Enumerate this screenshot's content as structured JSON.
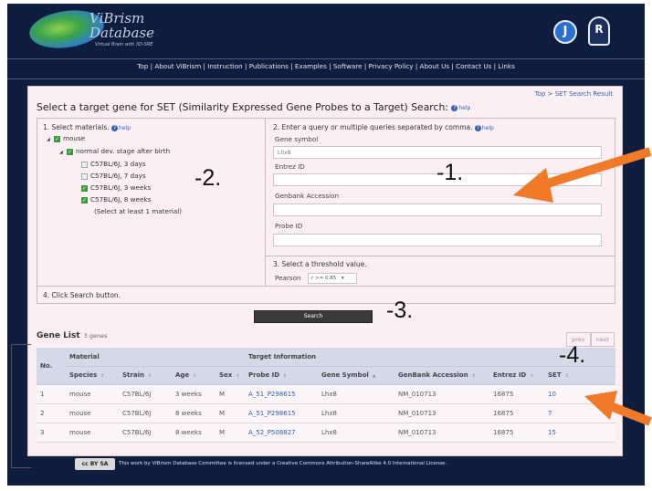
{
  "header": {
    "logo_title_line1": "ViBrism",
    "logo_title_line2": "Database",
    "logo_subtitle": "Virtual Brain with 3D-SRE",
    "badge_left": "J",
    "badge_right": "R"
  },
  "nav": [
    "Top",
    "About ViBrism",
    "Instruction",
    "Publications",
    "Examples",
    "Software",
    "Privacy Policy",
    "About Us",
    "Contact Us",
    "Links"
  ],
  "breadcrumb": {
    "top": "Top",
    "separator": ">",
    "current": "SET Search Result"
  },
  "page_title": "Select a target gene for SET (Similarity Expressed Gene Probes to a Target) Search:",
  "help_label": "help",
  "step1": {
    "label": "1. Select materials.",
    "tree": {
      "root": "mouse",
      "stage": "normal dev. stage after birth",
      "items": [
        {
          "label": "C57BL/6J, 3 days",
          "checked": false
        },
        {
          "label": "C57BL/6J, 7 days",
          "checked": false
        },
        {
          "label": "C57BL/6J, 3 weeks",
          "checked": true
        },
        {
          "label": "C57BL/6J, 8 weeks",
          "checked": true
        }
      ],
      "note": "(Select at least 1 material)"
    }
  },
  "step2": {
    "label": "2. Enter a query or multiple queries separated by comma.",
    "fields": {
      "gene_symbol": {
        "label": "Gene symbol",
        "value": "Lhx8"
      },
      "entrez_id": {
        "label": "Entrez ID",
        "value": ""
      },
      "genbank": {
        "label": "Genbank Accession",
        "value": ""
      },
      "probe_id": {
        "label": "Probe ID",
        "value": ""
      }
    }
  },
  "step3": {
    "label": "3. Select a threshold value.",
    "metric": "Pearson",
    "selected": "r >= 0.85"
  },
  "step4": {
    "label": "4. Click Search button.",
    "button": "Search"
  },
  "gene_list": {
    "title": "Gene List",
    "count": "3 genes",
    "prev": "prev",
    "next": "next",
    "group_material": "Material",
    "group_target": "Target Information",
    "col_no": "No.",
    "columns": [
      "Species",
      "Strain",
      "Age",
      "Sex",
      "Probe ID",
      "Gene Symbol",
      "GenBank Accession",
      "Entrez ID",
      "SET"
    ],
    "rows": [
      [
        "1",
        "mouse",
        "C57BL/6J",
        "3 weeks",
        "M",
        "A_51_P298615",
        "Lhx8",
        "NM_010713",
        "16875",
        "10"
      ],
      [
        "2",
        "mouse",
        "C57BL/6J",
        "8 weeks",
        "M",
        "A_51_P298615",
        "Lhx8",
        "NM_010713",
        "16875",
        "7"
      ],
      [
        "3",
        "mouse",
        "C57BL/6J",
        "8 weeks",
        "M",
        "A_52_P508827",
        "Lhx8",
        "NM_010713",
        "16875",
        "15"
      ]
    ]
  },
  "footer": {
    "cc_badge": "cc BY SA",
    "license": "This work by ViBrism Database Committee is licensed under a Creative Commons Attribution-ShareAlike 4.0 International License."
  },
  "annotations": {
    "a1": "-1.",
    "a2": "-2.",
    "a3": "-3.",
    "a4": "-4."
  },
  "colors": {
    "header_bg": "#0f1d3e",
    "panel_bg": "#fbeff3",
    "link": "#2f5fb0",
    "arrow": "#f07a28",
    "table_header": "#d3d9e8"
  }
}
